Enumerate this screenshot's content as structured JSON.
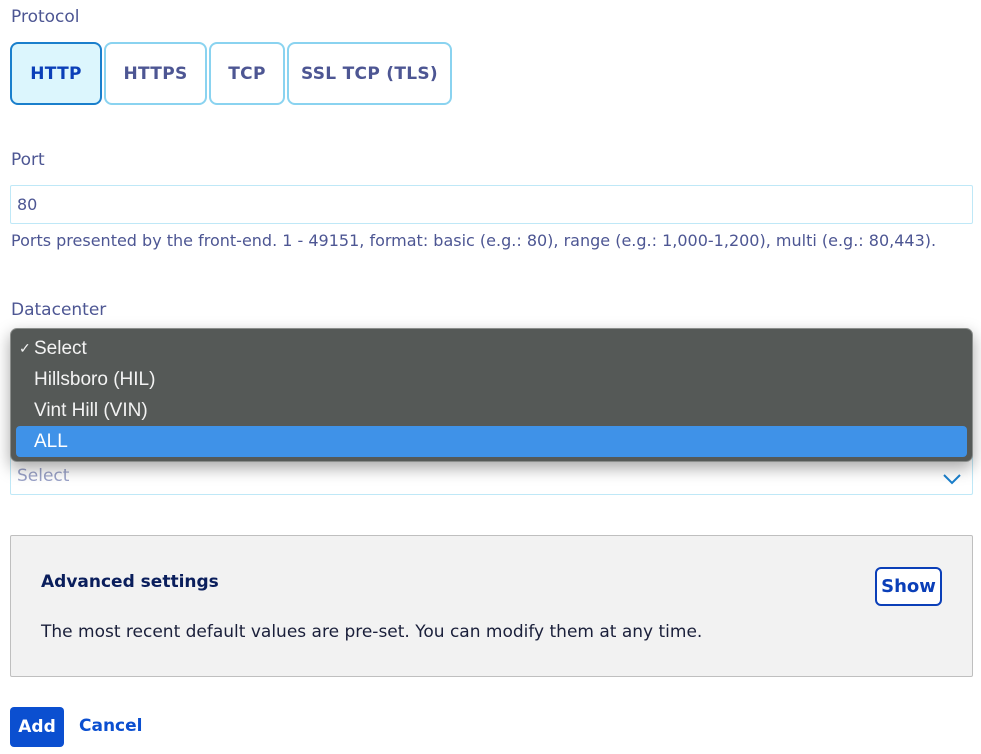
{
  "protocol": {
    "label": "Protocol",
    "options": [
      {
        "label": "HTTP",
        "selected": true
      },
      {
        "label": "HTTPS",
        "selected": false
      },
      {
        "label": "TCP",
        "selected": false
      },
      {
        "label": "SSL TCP (TLS)",
        "selected": false
      }
    ]
  },
  "port": {
    "label": "Port",
    "value": "80",
    "hint": "Ports presented by the front-end. 1 - 49151, format: basic (e.g.: 80), range (e.g.: 1,000-1,200), multi (e.g.: 80,443)."
  },
  "datacenter": {
    "label": "Datacenter",
    "dropdown_items": [
      {
        "label": "Select",
        "checked": true,
        "highlighted": false
      },
      {
        "label": "Hillsboro (HIL)",
        "checked": false,
        "highlighted": false
      },
      {
        "label": "Vint Hill (VIN)",
        "checked": false,
        "highlighted": false
      },
      {
        "label": "ALL",
        "checked": false,
        "highlighted": true
      }
    ],
    "check_glyph": "✓",
    "select_placeholder": "Select"
  },
  "advanced": {
    "title": "Advanced settings",
    "description": "The most recent default values are pre-set. You can modify them at any time.",
    "show_label": "Show"
  },
  "actions": {
    "add_label": "Add",
    "cancel_label": "Cancel"
  },
  "colors": {
    "accent": "#0b4fd0",
    "tile_border": "#8ad3f0",
    "tile_selected_bg": "#dcf6fd",
    "dropdown_highlight": "#3f92e8"
  }
}
